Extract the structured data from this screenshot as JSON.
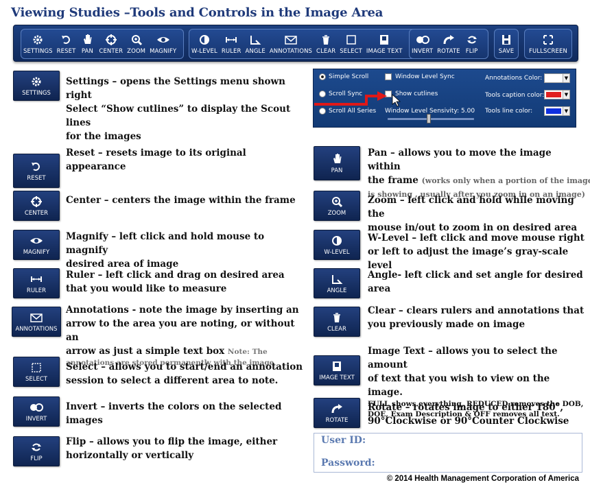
{
  "title": "Viewing Studies –Tools and Controls in the Image Area",
  "toolbar": {
    "settings": "SETTINGS",
    "reset": "RESET",
    "pan": "PAN",
    "center": "CENTER",
    "zoom": "ZOOM",
    "magnify": "MAGNIFY",
    "wlevel": "W-LEVEL",
    "ruler": "RULER",
    "angle": "ANGLE",
    "annotations": "ANNOTATIONS",
    "clear": "CLEAR",
    "select": "SELECT",
    "image_text": "IMAGE TEXT",
    "invert": "INVERT",
    "rotate": "ROTATE",
    "flip": "FLIP",
    "save": "SAVE",
    "fullscreen": "FULLSCREEN"
  },
  "tools": {
    "settings": {
      "tile": "SETTINGS",
      "line1": "Settings – opens the Settings menu shown right",
      "line2": "Select “Show cutlines” to display the Scout lines",
      "line3": "for the images"
    },
    "reset": {
      "tile": "RESET",
      "line1": "Reset – resets image to its original appearance"
    },
    "center": {
      "tile": "CENTER",
      "line1": "Center – centers the image within the frame"
    },
    "magnify": {
      "tile": "MAGNIFY",
      "line1": "Magnify – left click and hold mouse to magnify",
      "line2": "desired area of image"
    },
    "ruler": {
      "tile": "RULER",
      "line1": "Ruler – left click and drag on desired area",
      "line2": "that you would like to measure"
    },
    "annotations": {
      "tile": "ANNOTATIONS",
      "line1": "Annotations - note the image by inserting an",
      "line2": "arrow to the area you are noting, or without an",
      "line3": "arrow as just a simple text box",
      "note1": "Note: The",
      "note2": "annotations are stored permanently with the image"
    },
    "select": {
      "tile": "SELECT",
      "line1": "Select – allows you to start/end an annotation",
      "line2": "session to select a different area to note."
    },
    "invert": {
      "tile": "INVERT",
      "line1": "Invert – inverts the colors on the selected",
      "line2": "images"
    },
    "flip": {
      "tile": "FLIP",
      "line1": "Flip – allows you to flip the image, either",
      "line2": "horizontally or vertically"
    },
    "pan": {
      "tile": "PAN",
      "line1": "Pan – allows you to move the image within",
      "line2": "the frame",
      "small2": "(works only when a portion of  the image",
      "small3": "is showing , usually after you zoom in on an image)"
    },
    "zoom": {
      "tile": "ZOOM",
      "line1": "Zoom – left click and hold while moving the",
      "line2": "mouse in/out to zoom in on desired area"
    },
    "wlevel": {
      "tile": "W-LEVEL",
      "line1": "W-Level – left click and move mouse right",
      "line2": "or left to adjust the image’s gray-scale level"
    },
    "angle": {
      "tile": "ANGLE",
      "line1": "Angle- left click and set angle for desired",
      "line2": "area"
    },
    "clear": {
      "tile": "CLEAR",
      "line1": "Clear – clears rulers and annotations that",
      "line2": "you previously made on image"
    },
    "image_text": {
      "tile": "IMAGE TEXT",
      "line1": "Image Text – allows you to select the amount",
      "line2": "of text that you wish to view on the image.",
      "sub1": "FULL shows everything, REDUCED removes the DOB,",
      "sub2": "DOE, Exam Description & OFF removes all text."
    },
    "rotate": {
      "tile": "ROTATE",
      "line1": "Rotate – rotates image to either 180°,",
      "line2": "90°Clockwise or 90°Counter Clockwise"
    }
  },
  "settings_panel": {
    "simple_scroll": "Simple Scroll",
    "scroll_sync": "Scroll Sync",
    "scroll_all_series": "Scroll All Series",
    "window_level_sync": "Window Level Sync",
    "show_cutlines": "Show cutlines",
    "wl_sensitivity": "Window Level Sensivity:  5.00",
    "annotations_color": "Annotations Color:",
    "tools_caption_color": "Tools caption color:",
    "tools_line_color": "Tools line color:",
    "colors": {
      "annotations": "#ffffff",
      "caption": "#e02020",
      "line": "#1030e0"
    }
  },
  "login": {
    "user_id": "User ID:",
    "password": "Password:"
  },
  "footer": "© 2014 Health Management Corporation of America"
}
